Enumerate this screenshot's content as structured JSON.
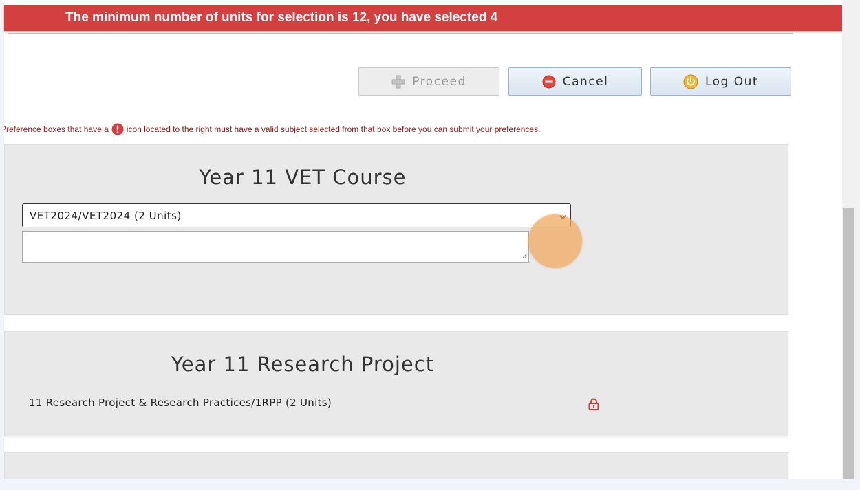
{
  "alert": {
    "message": "The minimum number of units for selection is 12, you have selected 4"
  },
  "buttons": {
    "proceed": "Proceed",
    "cancel": "Cancel",
    "logout": "Log Out"
  },
  "notice": {
    "before_icon": "Preference boxes that have a",
    "after_icon": "icon located to the right must have a valid subject selected from that box before you can submit your preferences."
  },
  "cards": {
    "vet": {
      "title": "Year 11 VET Course",
      "selected_option": "VET2024/VET2024 (2 Units)",
      "notes_value": ""
    },
    "research": {
      "title": "Year 11 Research Project",
      "item": "11 Research Project & Research Practices/1RPP (2 Units)"
    }
  },
  "icons": {
    "proceed": "plus-icon",
    "cancel": "minus-circle-icon",
    "logout": "power-icon",
    "notice": "exclamation-circle-icon",
    "locked": "lock-icon"
  },
  "colors": {
    "alert": "#d3403f",
    "notice_text": "#8b1a1a",
    "lock": "#d63a3a",
    "logout_icon": "#e0a21b",
    "cancel_icon": "#e4473c"
  }
}
